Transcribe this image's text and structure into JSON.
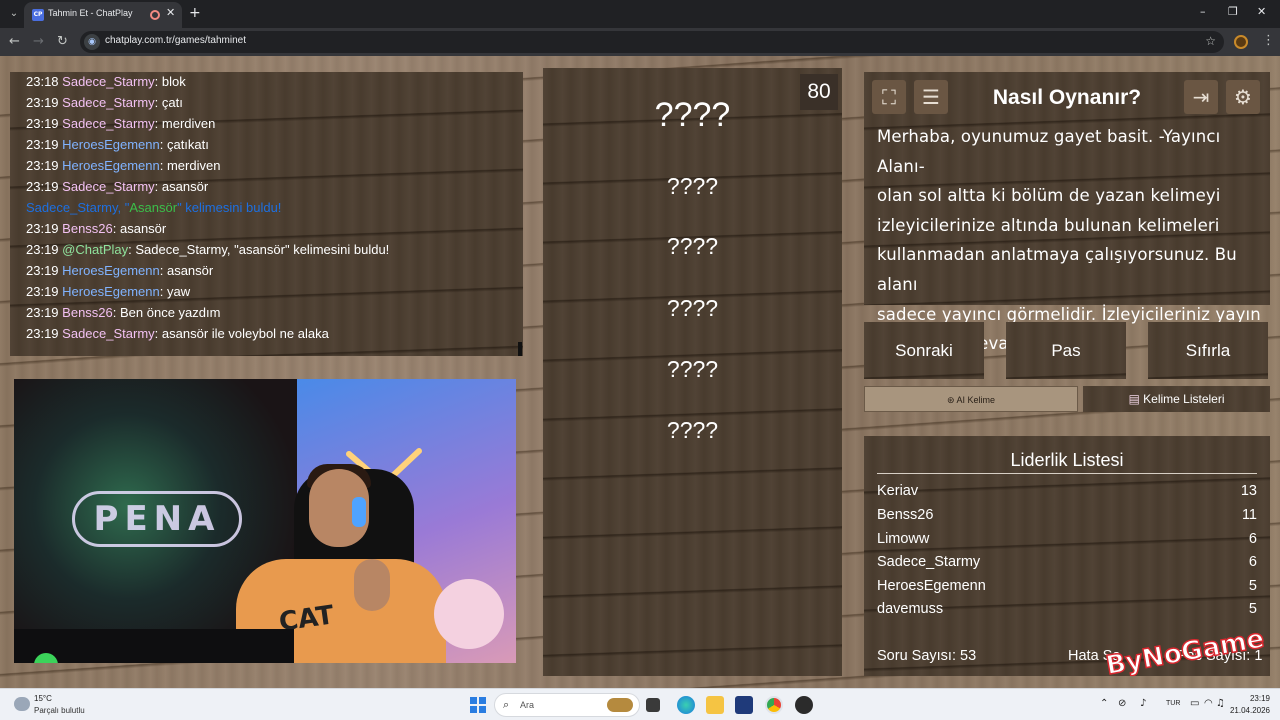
{
  "browser": {
    "tab_title": "Tahmin Et - ChatPlay",
    "tab_favicon_text": "CP",
    "url": "chatplay.com.tr/games/tahminet",
    "new_tab": "+",
    "minimize": "–",
    "maximize": "❐",
    "close": "✕",
    "icons": [
      "tab-search-icon",
      "recording-icon",
      "close-icon",
      "back-icon",
      "forward-icon",
      "reload-icon",
      "site-info-icon",
      "bookmark-star-icon",
      "profile-avatar-icon",
      "menu-kebab-icon"
    ]
  },
  "chat": {
    "lines": [
      {
        "time": "23:18",
        "user": "Sadece_Starmy",
        "user_color": "#f2c1f2",
        "msg": ": blok"
      },
      {
        "time": "23:19",
        "user": "Sadece_Starmy",
        "user_color": "#f2c1f2",
        "msg": ": çatı"
      },
      {
        "time": "23:19",
        "user": "Sadece_Starmy",
        "user_color": "#f2c1f2",
        "msg": ": merdiven"
      },
      {
        "time": "23:19",
        "user": "HeroesEgemenn",
        "user_color": "#80b3ff",
        "msg": ": çatıkatı"
      },
      {
        "time": "23:19",
        "user": "HeroesEgemenn",
        "user_color": "#80b3ff",
        "msg": ": merdiven"
      },
      {
        "time": "23:19",
        "user": "Sadece_Starmy",
        "user_color": "#f2c1f2",
        "msg": ": asansör"
      },
      {
        "time": "23:19",
        "user": "Benss26",
        "user_color": "#f2c1f2",
        "msg": ": asansör"
      },
      {
        "time": "23:19",
        "user": "@ChatPlay",
        "user_color": "#8fe39d",
        "msg": ": Sadece_Starmy, \"asansör\" kelimesini buldu!"
      },
      {
        "time": "23:19",
        "user": "HeroesEgemenn",
        "user_color": "#80b3ff",
        "msg": ": asansör"
      },
      {
        "time": "23:19",
        "user": "HeroesEgemenn",
        "user_color": "#80b3ff",
        "msg": ": yaw"
      },
      {
        "time": "23:19",
        "user": "Benss26",
        "user_color": "#f2c1f2",
        "msg": ": Ben önce yazdım"
      },
      {
        "time": "23:19",
        "user": "Sadece_Starmy",
        "user_color": "#f2c1f2",
        "msg": ": asansör ile voleybol ne alaka"
      }
    ],
    "system": {
      "prefix": "Sadece_Starmy, \"",
      "word": "Asansör",
      "suffix": "\" kelimesini buldu!"
    }
  },
  "webcam": {
    "logo_text": "PENA",
    "shirt_text": "CAT"
  },
  "words": {
    "timer": "80",
    "main": "????",
    "rows": [
      "????",
      "????",
      "????",
      "????",
      "????"
    ]
  },
  "help": {
    "title": "Nasıl Oynanır?",
    "lines": [
      "Merhaba, oyunumuz gayet basit. -Yayıncı Alanı-",
      "olan sol altta ki bölüm de yazan kelimeyi",
      "izleyicilerinize altında bulunan kelimeleri",
      "kullanmadan anlatmaya çalışıyorsunuz. Bu alanı",
      "sadece yayıncı görmelidir. İzleyicileriniz yayın",
      "chatinizde cevap verebilir."
    ],
    "icons": [
      "fullscreen-icon",
      "word-list-icon",
      "exit-icon",
      "settings-gear-icon"
    ]
  },
  "controls": {
    "next": "Sonraki",
    "pass": "Pas",
    "reset": "Sıfırla",
    "ai_tab": "AI Kelime",
    "list_tab": "Kelime Listeleri"
  },
  "leaderboard": {
    "title": "Liderlik Listesi",
    "rows": [
      {
        "name": "Keriav",
        "score": "13"
      },
      {
        "name": "Benss26",
        "score": "11"
      },
      {
        "name": "Limoww",
        "score": "6"
      },
      {
        "name": "Sadece_Starmy",
        "score": "6"
      },
      {
        "name": "HeroesEgemenn",
        "score": "5"
      },
      {
        "name": "davemuss",
        "score": "5"
      }
    ],
    "question_count": "Soru Sayısı: 53",
    "error_count": "Hata Sa",
    "pass_count": "Pas Sayısı: 1"
  },
  "overlay_logo_text": "ByNoGame",
  "taskbar": {
    "temp": "15°C",
    "weather": "Parçalı bulutlu",
    "search_placeholder": "Ara",
    "lang": "TUR",
    "time": "23:19",
    "date": "21.04.2026",
    "pinned": [
      "windows-start-icon",
      "search-icon",
      "task-view-icon",
      "edge-icon",
      "file-explorer-icon",
      "store-icon",
      "chrome-icon",
      "obs-icon"
    ],
    "tray_icons": [
      "chevron-up-icon",
      "network-off-icon",
      "microphone-icon",
      "display-icon",
      "wifi-icon",
      "volume-icon",
      "battery-icon"
    ]
  }
}
